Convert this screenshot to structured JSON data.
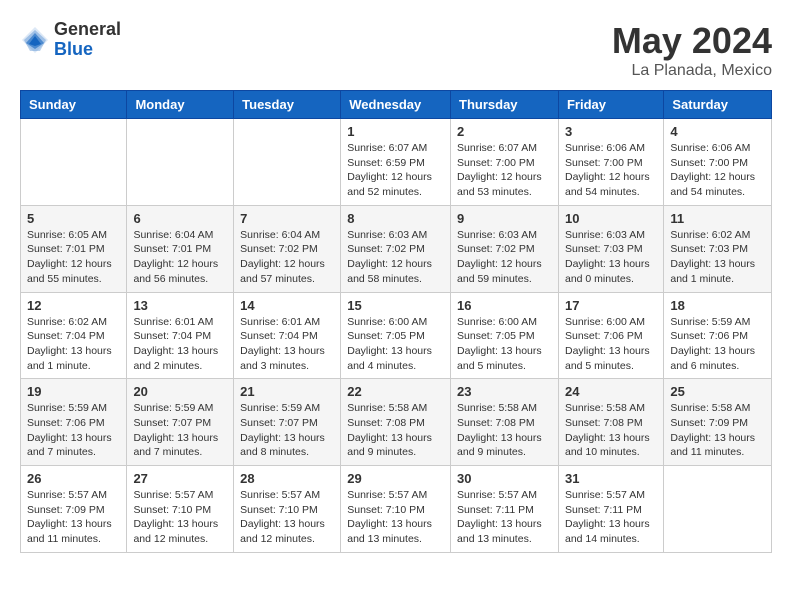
{
  "logo": {
    "general": "General",
    "blue": "Blue"
  },
  "title": {
    "month": "May 2024",
    "location": "La Planada, Mexico"
  },
  "weekdays": [
    "Sunday",
    "Monday",
    "Tuesday",
    "Wednesday",
    "Thursday",
    "Friday",
    "Saturday"
  ],
  "weeks": [
    [
      {
        "day": "",
        "info": ""
      },
      {
        "day": "",
        "info": ""
      },
      {
        "day": "",
        "info": ""
      },
      {
        "day": "1",
        "info": "Sunrise: 6:07 AM\nSunset: 6:59 PM\nDaylight: 12 hours\nand 52 minutes."
      },
      {
        "day": "2",
        "info": "Sunrise: 6:07 AM\nSunset: 7:00 PM\nDaylight: 12 hours\nand 53 minutes."
      },
      {
        "day": "3",
        "info": "Sunrise: 6:06 AM\nSunset: 7:00 PM\nDaylight: 12 hours\nand 54 minutes."
      },
      {
        "day": "4",
        "info": "Sunrise: 6:06 AM\nSunset: 7:00 PM\nDaylight: 12 hours\nand 54 minutes."
      }
    ],
    [
      {
        "day": "5",
        "info": "Sunrise: 6:05 AM\nSunset: 7:01 PM\nDaylight: 12 hours\nand 55 minutes."
      },
      {
        "day": "6",
        "info": "Sunrise: 6:04 AM\nSunset: 7:01 PM\nDaylight: 12 hours\nand 56 minutes."
      },
      {
        "day": "7",
        "info": "Sunrise: 6:04 AM\nSunset: 7:02 PM\nDaylight: 12 hours\nand 57 minutes."
      },
      {
        "day": "8",
        "info": "Sunrise: 6:03 AM\nSunset: 7:02 PM\nDaylight: 12 hours\nand 58 minutes."
      },
      {
        "day": "9",
        "info": "Sunrise: 6:03 AM\nSunset: 7:02 PM\nDaylight: 12 hours\nand 59 minutes."
      },
      {
        "day": "10",
        "info": "Sunrise: 6:03 AM\nSunset: 7:03 PM\nDaylight: 13 hours\nand 0 minutes."
      },
      {
        "day": "11",
        "info": "Sunrise: 6:02 AM\nSunset: 7:03 PM\nDaylight: 13 hours\nand 1 minute."
      }
    ],
    [
      {
        "day": "12",
        "info": "Sunrise: 6:02 AM\nSunset: 7:04 PM\nDaylight: 13 hours\nand 1 minute."
      },
      {
        "day": "13",
        "info": "Sunrise: 6:01 AM\nSunset: 7:04 PM\nDaylight: 13 hours\nand 2 minutes."
      },
      {
        "day": "14",
        "info": "Sunrise: 6:01 AM\nSunset: 7:04 PM\nDaylight: 13 hours\nand 3 minutes."
      },
      {
        "day": "15",
        "info": "Sunrise: 6:00 AM\nSunset: 7:05 PM\nDaylight: 13 hours\nand 4 minutes."
      },
      {
        "day": "16",
        "info": "Sunrise: 6:00 AM\nSunset: 7:05 PM\nDaylight: 13 hours\nand 5 minutes."
      },
      {
        "day": "17",
        "info": "Sunrise: 6:00 AM\nSunset: 7:06 PM\nDaylight: 13 hours\nand 5 minutes."
      },
      {
        "day": "18",
        "info": "Sunrise: 5:59 AM\nSunset: 7:06 PM\nDaylight: 13 hours\nand 6 minutes."
      }
    ],
    [
      {
        "day": "19",
        "info": "Sunrise: 5:59 AM\nSunset: 7:06 PM\nDaylight: 13 hours\nand 7 minutes."
      },
      {
        "day": "20",
        "info": "Sunrise: 5:59 AM\nSunset: 7:07 PM\nDaylight: 13 hours\nand 7 minutes."
      },
      {
        "day": "21",
        "info": "Sunrise: 5:59 AM\nSunset: 7:07 PM\nDaylight: 13 hours\nand 8 minutes."
      },
      {
        "day": "22",
        "info": "Sunrise: 5:58 AM\nSunset: 7:08 PM\nDaylight: 13 hours\nand 9 minutes."
      },
      {
        "day": "23",
        "info": "Sunrise: 5:58 AM\nSunset: 7:08 PM\nDaylight: 13 hours\nand 9 minutes."
      },
      {
        "day": "24",
        "info": "Sunrise: 5:58 AM\nSunset: 7:08 PM\nDaylight: 13 hours\nand 10 minutes."
      },
      {
        "day": "25",
        "info": "Sunrise: 5:58 AM\nSunset: 7:09 PM\nDaylight: 13 hours\nand 11 minutes."
      }
    ],
    [
      {
        "day": "26",
        "info": "Sunrise: 5:57 AM\nSunset: 7:09 PM\nDaylight: 13 hours\nand 11 minutes."
      },
      {
        "day": "27",
        "info": "Sunrise: 5:57 AM\nSunset: 7:10 PM\nDaylight: 13 hours\nand 12 minutes."
      },
      {
        "day": "28",
        "info": "Sunrise: 5:57 AM\nSunset: 7:10 PM\nDaylight: 13 hours\nand 12 minutes."
      },
      {
        "day": "29",
        "info": "Sunrise: 5:57 AM\nSunset: 7:10 PM\nDaylight: 13 hours\nand 13 minutes."
      },
      {
        "day": "30",
        "info": "Sunrise: 5:57 AM\nSunset: 7:11 PM\nDaylight: 13 hours\nand 13 minutes."
      },
      {
        "day": "31",
        "info": "Sunrise: 5:57 AM\nSunset: 7:11 PM\nDaylight: 13 hours\nand 14 minutes."
      },
      {
        "day": "",
        "info": ""
      }
    ]
  ]
}
